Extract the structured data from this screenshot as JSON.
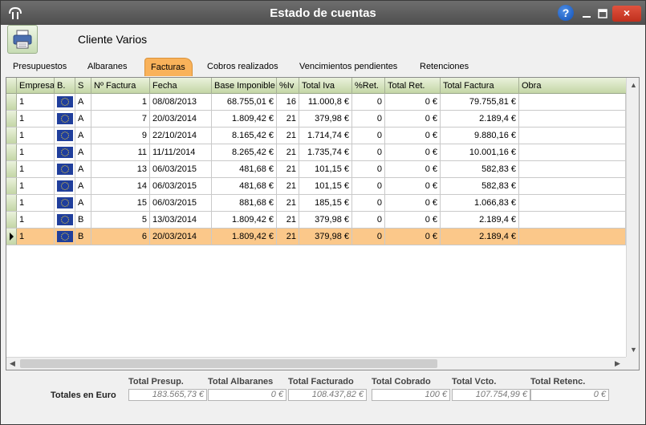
{
  "window": {
    "title": "Estado de cuentas"
  },
  "controls": {
    "help": "?",
    "close": "×"
  },
  "header": {
    "client_name": "Cliente Varios"
  },
  "tabs": [
    {
      "label": "Presupuestos",
      "active": false
    },
    {
      "label": "Albaranes",
      "active": false
    },
    {
      "label": "Facturas",
      "active": true
    },
    {
      "label": "Cobros realizados",
      "active": false
    },
    {
      "label": "Vencimientos pendientes",
      "active": false
    },
    {
      "label": "Retenciones",
      "active": false
    }
  ],
  "table": {
    "columns": [
      "Empresa",
      "B.",
      "S",
      "Nº Factura",
      "Fecha",
      "Base Imponible",
      "%Iv",
      "Total Iva",
      "%Ret.",
      "Total Ret.",
      "Total Factura",
      "Obra"
    ],
    "rows": [
      {
        "empresa": "1",
        "serie": "A",
        "numero": "1",
        "fecha": "08/08/2013",
        "base": "68.755,01 €",
        "iva_pct": "16",
        "total_iva": "11.000,8 €",
        "ret_pct": "0",
        "total_ret": "0 €",
        "total_factura": "79.755,81 €",
        "obra": "",
        "selected": false
      },
      {
        "empresa": "1",
        "serie": "A",
        "numero": "7",
        "fecha": "20/03/2014",
        "base": "1.809,42 €",
        "iva_pct": "21",
        "total_iva": "379,98 €",
        "ret_pct": "0",
        "total_ret": "0 €",
        "total_factura": "2.189,4 €",
        "obra": "",
        "selected": false
      },
      {
        "empresa": "1",
        "serie": "A",
        "numero": "9",
        "fecha": "22/10/2014",
        "base": "8.165,42 €",
        "iva_pct": "21",
        "total_iva": "1.714,74 €",
        "ret_pct": "0",
        "total_ret": "0 €",
        "total_factura": "9.880,16 €",
        "obra": "",
        "selected": false
      },
      {
        "empresa": "1",
        "serie": "A",
        "numero": "11",
        "fecha": "11/11/2014",
        "base": "8.265,42 €",
        "iva_pct": "21",
        "total_iva": "1.735,74 €",
        "ret_pct": "0",
        "total_ret": "0 €",
        "total_factura": "10.001,16 €",
        "obra": "",
        "selected": false
      },
      {
        "empresa": "1",
        "serie": "A",
        "numero": "13",
        "fecha": "06/03/2015",
        "base": "481,68 €",
        "iva_pct": "21",
        "total_iva": "101,15 €",
        "ret_pct": "0",
        "total_ret": "0 €",
        "total_factura": "582,83 €",
        "obra": "",
        "selected": false
      },
      {
        "empresa": "1",
        "serie": "A",
        "numero": "14",
        "fecha": "06/03/2015",
        "base": "481,68 €",
        "iva_pct": "21",
        "total_iva": "101,15 €",
        "ret_pct": "0",
        "total_ret": "0 €",
        "total_factura": "582,83 €",
        "obra": "",
        "selected": false
      },
      {
        "empresa": "1",
        "serie": "A",
        "numero": "15",
        "fecha": "06/03/2015",
        "base": "881,68 €",
        "iva_pct": "21",
        "total_iva": "185,15 €",
        "ret_pct": "0",
        "total_ret": "0 €",
        "total_factura": "1.066,83 €",
        "obra": "",
        "selected": false
      },
      {
        "empresa": "1",
        "serie": "B",
        "numero": "5",
        "fecha": "13/03/2014",
        "base": "1.809,42 €",
        "iva_pct": "21",
        "total_iva": "379,98 €",
        "ret_pct": "0",
        "total_ret": "0 €",
        "total_factura": "2.189,4 €",
        "obra": "",
        "selected": false
      },
      {
        "empresa": "1",
        "serie": "B",
        "numero": "6",
        "fecha": "20/03/2014",
        "base": "1.809,42 €",
        "iva_pct": "21",
        "total_iva": "379,98 €",
        "ret_pct": "0",
        "total_ret": "0 €",
        "total_factura": "2.189,4 €",
        "obra": "",
        "selected": true
      }
    ]
  },
  "totals": {
    "row_label": "Totales en Euro",
    "items": [
      {
        "label": "Total Presup.",
        "value": "183.565,73 €"
      },
      {
        "label": "Total Albaranes",
        "value": "0 €"
      },
      {
        "label": "Total Facturado",
        "value": "108.437,82 €"
      },
      {
        "label": "Total Cobrado",
        "value": "100 €"
      },
      {
        "label": "Total Vcto.",
        "value": "107.754,99 €"
      },
      {
        "label": "Total Retenc.",
        "value": "0 €"
      }
    ]
  },
  "colors": {
    "selected_row": "#fbc88a",
    "active_tab": "#f9b25a",
    "header": "#c4d6a6"
  }
}
